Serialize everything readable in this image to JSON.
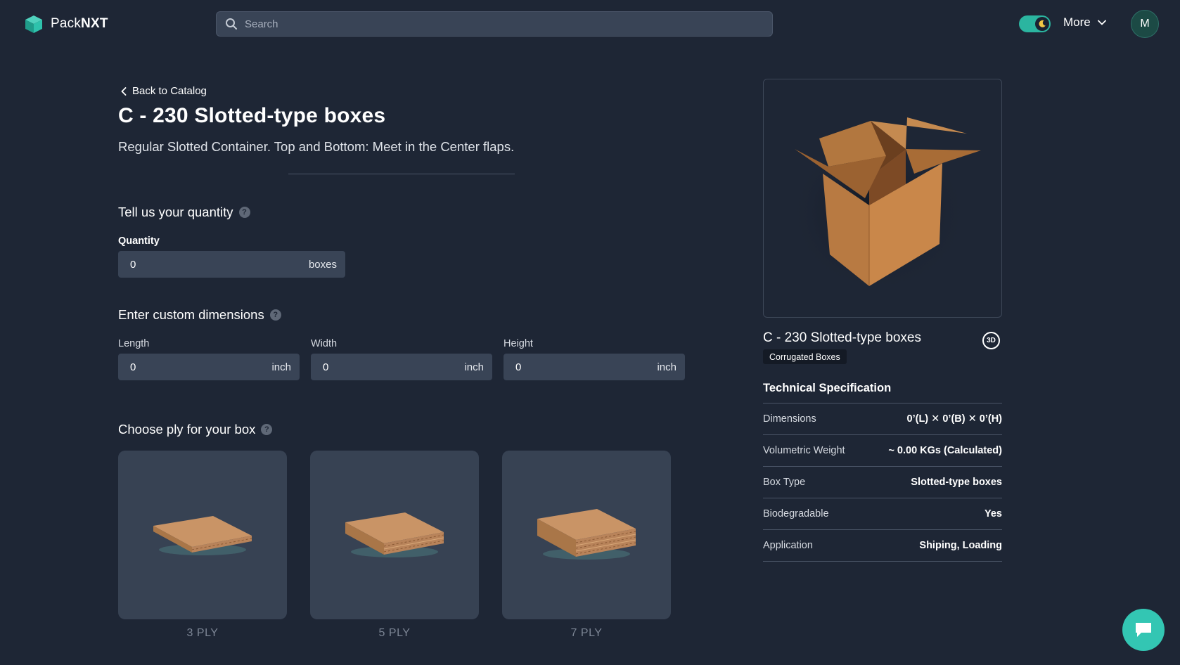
{
  "header": {
    "brand_regular": "Pack",
    "brand_bold": "NXT",
    "search_placeholder": "Search",
    "more_label": "More",
    "avatar_initial": "M"
  },
  "product": {
    "back_label": "Back to Catalog",
    "title": "C - 230 Slotted-type boxes",
    "subtitle": "Regular Slotted Container. Top and Bottom: Meet in the Center flaps."
  },
  "quantity": {
    "section_title": "Tell us your quantity",
    "label": "Quantity",
    "value": "0",
    "unit": "boxes"
  },
  "dimensions": {
    "section_title": "Enter custom dimensions",
    "fields": [
      {
        "label": "Length",
        "value": "0",
        "unit": "inch"
      },
      {
        "label": "Width",
        "value": "0",
        "unit": "inch"
      },
      {
        "label": "Height",
        "value": "0",
        "unit": "inch"
      }
    ]
  },
  "ply": {
    "section_title": "Choose ply for your box",
    "options": [
      {
        "label": "3 PLY"
      },
      {
        "label": "5 PLY"
      },
      {
        "label": "7 PLY"
      }
    ]
  },
  "sidebar": {
    "product_name": "C - 230 Slotted-type boxes",
    "badge_3d": "3D",
    "category": "Corrugated Boxes",
    "spec_title": "Technical Specification",
    "specs": [
      {
        "key": "Dimensions",
        "value": "0’(L) ✕ 0’(B) ✕ 0’(H)"
      },
      {
        "key": "Volumetric Weight",
        "value": "~ 0.00 KGs (Calculated)"
      },
      {
        "key": "Box Type",
        "value": "Slotted-type boxes"
      },
      {
        "key": "Biodegradable",
        "value": "Yes"
      },
      {
        "key": "Application",
        "value": "Shiping, Loading"
      }
    ]
  },
  "colors": {
    "background": "#1e2635",
    "field": "#394456",
    "card": "#374253",
    "accent": "#33c6b3",
    "cardboard": "#c07a3e"
  },
  "icons": [
    "logo-cube-icon",
    "search-icon",
    "moon-icon",
    "chevron-down-icon",
    "chevron-left-icon",
    "help-icon",
    "chat-icon"
  ]
}
